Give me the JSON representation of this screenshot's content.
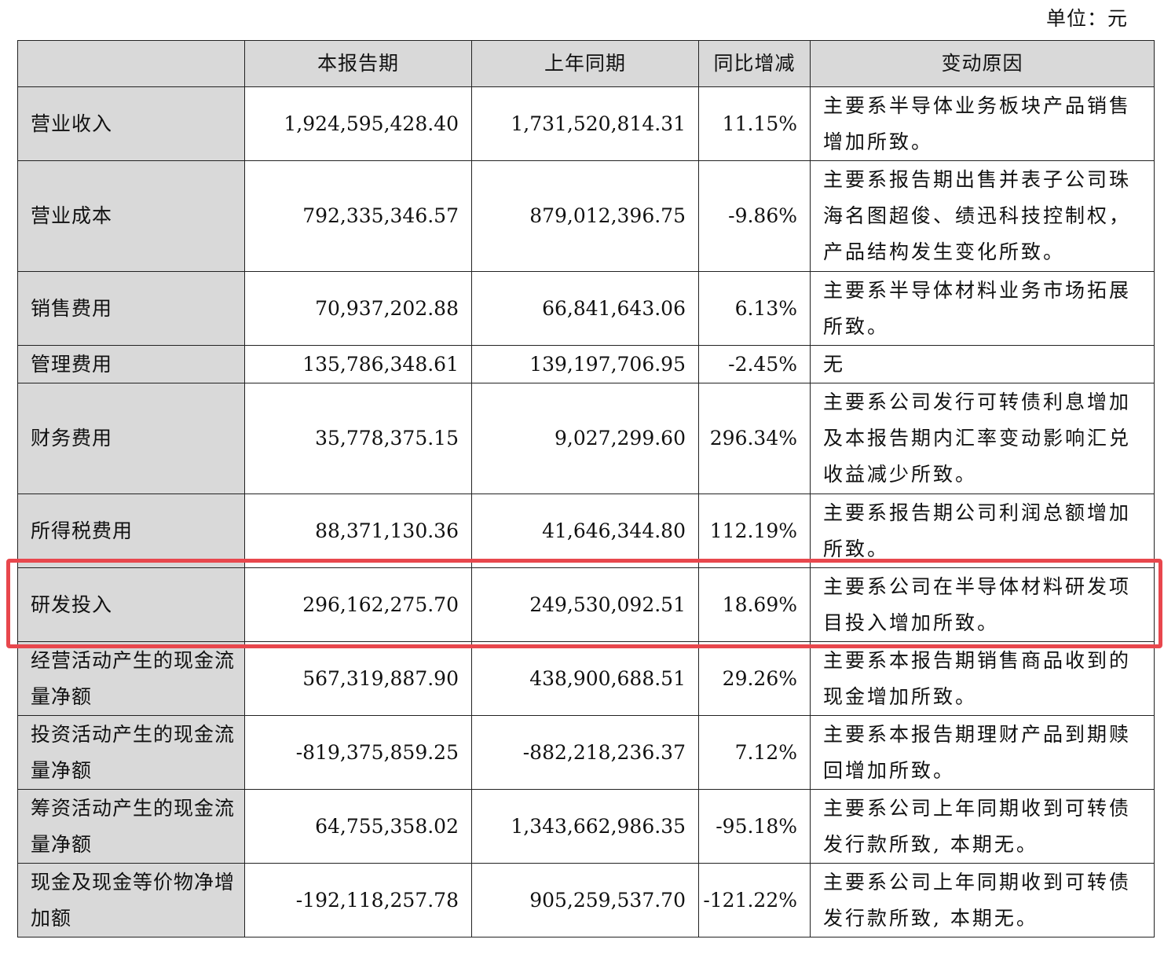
{
  "unit_label": "单位：元",
  "colors": {
    "header_bg": "#d9d9d9",
    "highlight": "#e8474d"
  },
  "table": {
    "headers": [
      "",
      "本报告期",
      "上年同期",
      "同比增减",
      "变动原因"
    ],
    "rows": [
      {
        "item": "营业收入",
        "current": "1,924,595,428.40",
        "prior": "1,731,520,814.31",
        "change": "11.15%",
        "reason": "主要系半导体业务板块产品销售增加所致。",
        "highlighted": false
      },
      {
        "item": "营业成本",
        "current": "792,335,346.57",
        "prior": "879,012,396.75",
        "change": "-9.86%",
        "reason": "主要系报告期出售并表子公司珠海名图超俊、绩迅科技控制权，产品结构发生变化所致。",
        "highlighted": false
      },
      {
        "item": "销售费用",
        "current": "70,937,202.88",
        "prior": "66,841,643.06",
        "change": "6.13%",
        "reason": "主要系半导体材料业务市场拓展所致。",
        "highlighted": false
      },
      {
        "item": "管理费用",
        "current": "135,786,348.61",
        "prior": "139,197,706.95",
        "change": "-2.45%",
        "reason": "无",
        "highlighted": false
      },
      {
        "item": "财务费用",
        "current": "35,778,375.15",
        "prior": "9,027,299.60",
        "change": "296.34%",
        "reason": "主要系公司发行可转债利息增加及本报告期内汇率变动影响汇兑收益减少所致。",
        "highlighted": false
      },
      {
        "item": "所得税费用",
        "current": "88,371,130.36",
        "prior": "41,646,344.80",
        "change": "112.19%",
        "reason": "主要系报告期公司利润总额增加所致。",
        "highlighted": false
      },
      {
        "item": "研发投入",
        "current": "296,162,275.70",
        "prior": "249,530,092.51",
        "change": "18.69%",
        "reason": "主要系公司在半导体材料研发项目投入增加所致。",
        "highlighted": true
      },
      {
        "item": "经营活动产生的现金流量净额",
        "current": "567,319,887.90",
        "prior": "438,900,688.51",
        "change": "29.26%",
        "reason": "主要系本报告期销售商品收到的现金增加所致。",
        "highlighted": false
      },
      {
        "item": "投资活动产生的现金流量净额",
        "current": "-819,375,859.25",
        "prior": "-882,218,236.37",
        "change": "7.12%",
        "reason": "主要系本报告期理财产品到期赎回增加所致。",
        "highlighted": false
      },
      {
        "item": "筹资活动产生的现金流量净额",
        "current": "64,755,358.02",
        "prior": "1,343,662,986.35",
        "change": "-95.18%",
        "reason": "主要系公司上年同期收到可转债发行款所致, 本期无。",
        "highlighted": false
      },
      {
        "item": "现金及现金等价物净增加额",
        "current": "-192,118,257.78",
        "prior": "905,259,537.70",
        "change": "-121.22%",
        "reason": "主要系公司上年同期收到可转债发行款所致, 本期无。",
        "highlighted": false
      }
    ]
  }
}
